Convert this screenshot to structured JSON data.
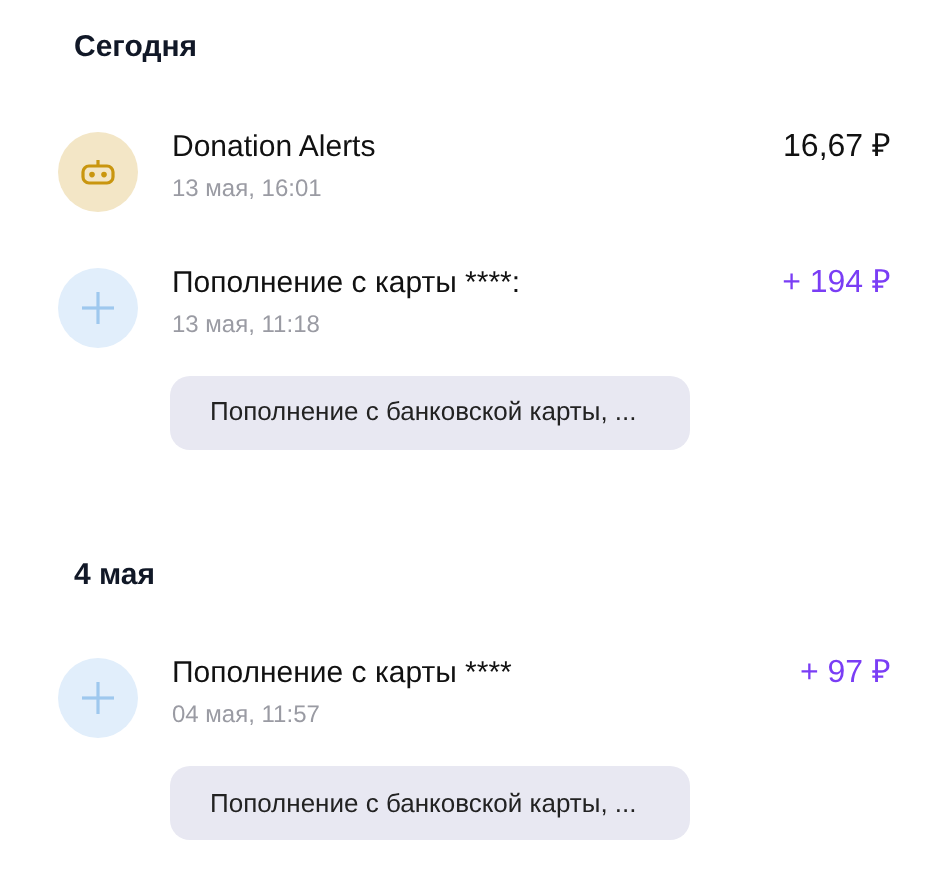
{
  "groups": [
    {
      "date": "Сегодня",
      "transactions": [
        {
          "kind": "payment",
          "title": "Donation Alerts",
          "time": "13 мая, 16:01",
          "amount": "16,67 ₽"
        },
        {
          "kind": "topup",
          "title": "Пополнение с карты ****:",
          "time": "13 мая, 11:18",
          "amount": "+ 194 ₽",
          "note": "Пополнение с банковской карты, ..."
        }
      ]
    },
    {
      "date": "4 мая",
      "transactions": [
        {
          "kind": "topup",
          "title": "Пополнение с карты ****",
          "time": "04 мая, 11:57",
          "amount": "+ 97 ₽",
          "note": "Пополнение с банковской карты, ..."
        }
      ]
    }
  ]
}
